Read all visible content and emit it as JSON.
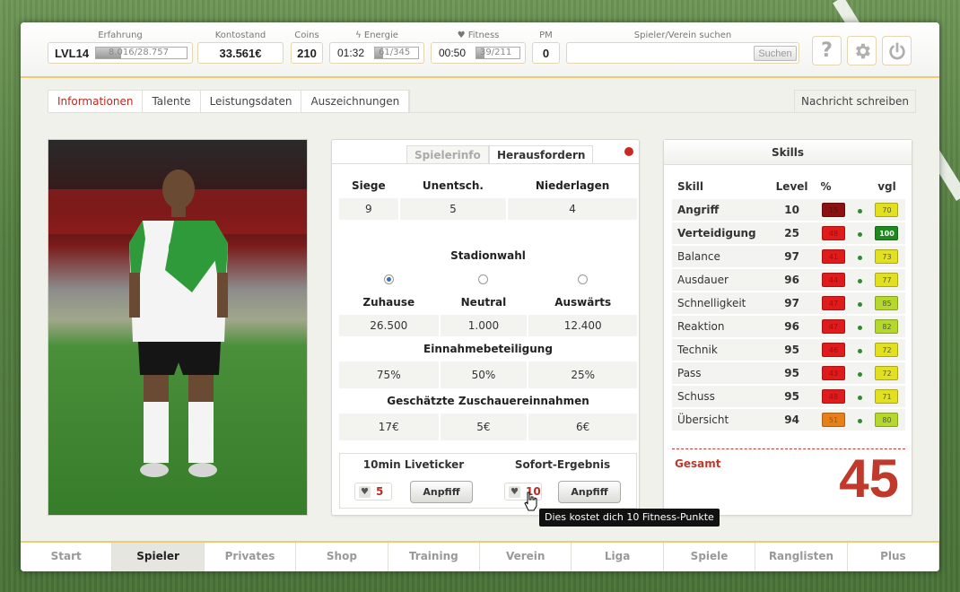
{
  "topbar": {
    "erfahrung_label": "Erfahrung",
    "level": "LVL14",
    "erfahrung_value": "8.016/28.757",
    "erfahrung_fraction": 0.28,
    "kontostand_label": "Kontostand",
    "kontostand_value": "33.561€",
    "coins_label": "Coins",
    "coins_value": "210",
    "energie_label": "Energie",
    "energie_timer": "01:32",
    "energie_value": "61/345",
    "energie_fraction": 0.18,
    "fitness_label": "Fitness",
    "fitness_timer": "00:50",
    "fitness_value": "39/211",
    "fitness_fraction": 0.18,
    "pm_label": "PM",
    "pm_value": "0",
    "search_label": "Spieler/Verein suchen",
    "search_value": "",
    "search_button": "Suchen",
    "icons": [
      "help-icon",
      "gear-icon",
      "power-icon"
    ]
  },
  "tabs": [
    "Informationen",
    "Talente",
    "Leistungsdaten",
    "Auszeichnungen"
  ],
  "message_button": "Nachricht schreiben",
  "challenge": {
    "tabs": [
      "Spielerinfo",
      "Herausfordern"
    ],
    "record_headers": [
      "Siege",
      "Unentsch.",
      "Niederlagen"
    ],
    "record_values": [
      "9",
      "5",
      "4"
    ],
    "stadium_title": "Stadionwahl",
    "stadium_selected": 0,
    "venue_headers": [
      "Zuhause",
      "Neutral",
      "Auswärts"
    ],
    "venue_values": [
      "26.500",
      "1.000",
      "12.400"
    ],
    "share_title": "Einnahmebeteiligung",
    "share_values": [
      "75%",
      "50%",
      "25%"
    ],
    "income_title": "Geschätzte Zuschauereinnahmen",
    "income_values": [
      "17€",
      "5€",
      "6€"
    ],
    "live_title": "10min Liveticker",
    "live_cost": "5",
    "live_button": "Anpfiff",
    "instant_title": "Sofort-Ergebnis",
    "instant_cost": "10",
    "instant_button": "Anpfiff",
    "tooltip": "Dies kostet dich 10 Fitness-Punkte"
  },
  "skills": {
    "title": "Skills",
    "headers": [
      "Skill",
      "Level",
      "%",
      "vgl"
    ],
    "rows": [
      {
        "name": "Angriff",
        "level": "10",
        "pct": "15",
        "pct_color": "#8b1010",
        "vgl": "70",
        "vgl_color": "#e3e020",
        "bold": true
      },
      {
        "name": "Verteidigung",
        "level": "25",
        "pct": "48",
        "pct_color": "#e01b1b",
        "vgl": "100",
        "vgl_color": "#1e8a1e",
        "bold": true
      },
      {
        "name": "Balance",
        "level": "97",
        "pct": "41",
        "pct_color": "#e01b1b",
        "vgl": "73",
        "vgl_color": "#e3e020",
        "bold": false
      },
      {
        "name": "Ausdauer",
        "level": "96",
        "pct": "44",
        "pct_color": "#e01b1b",
        "vgl": "77",
        "vgl_color": "#e3e020",
        "bold": false
      },
      {
        "name": "Schnelligkeit",
        "level": "97",
        "pct": "47",
        "pct_color": "#e01b1b",
        "vgl": "85",
        "vgl_color": "#b6d82a",
        "bold": false
      },
      {
        "name": "Reaktion",
        "level": "96",
        "pct": "47",
        "pct_color": "#e01b1b",
        "vgl": "82",
        "vgl_color": "#b6d82a",
        "bold": false
      },
      {
        "name": "Technik",
        "level": "95",
        "pct": "46",
        "pct_color": "#e01b1b",
        "vgl": "72",
        "vgl_color": "#e3e020",
        "bold": false
      },
      {
        "name": "Pass",
        "level": "95",
        "pct": "43",
        "pct_color": "#e01b1b",
        "vgl": "72",
        "vgl_color": "#e3e020",
        "bold": false
      },
      {
        "name": "Schuss",
        "level": "95",
        "pct": "48",
        "pct_color": "#e01b1b",
        "vgl": "71",
        "vgl_color": "#e3e020",
        "bold": false
      },
      {
        "name": "Übersicht",
        "level": "94",
        "pct": "51",
        "pct_color": "#e6801a",
        "vgl": "80",
        "vgl_color": "#b6d82a",
        "bold": false
      }
    ],
    "total_label": "Gesamt",
    "total_value": "45"
  },
  "nav": [
    "Start",
    "Spieler",
    "Privates",
    "Shop",
    "Training",
    "Verein",
    "Liga",
    "Spiele",
    "Ranglisten",
    "Plus"
  ],
  "nav_active": 1
}
